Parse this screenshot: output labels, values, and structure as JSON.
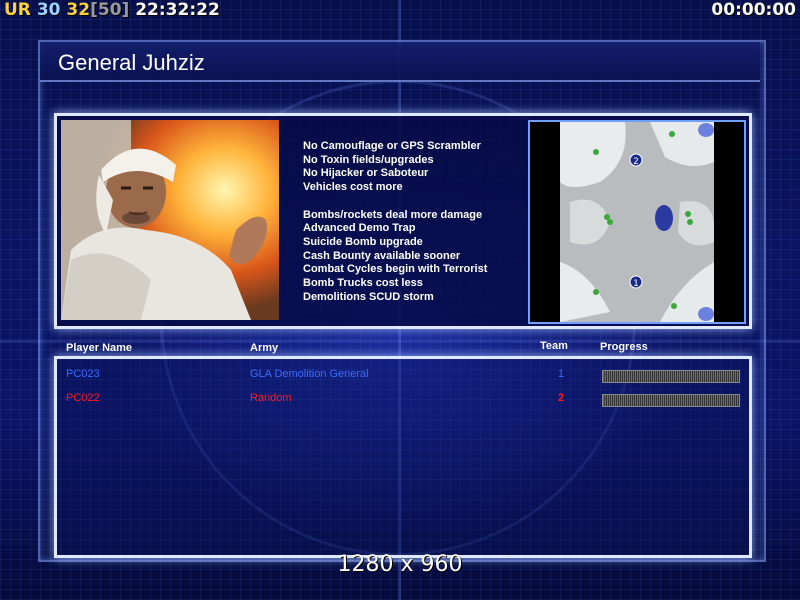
{
  "hud": {
    "tag": "UR",
    "fps": "30",
    "fps_current": "32",
    "fps_cap": "[50]",
    "clock": "22:32:22",
    "timer": "00:00:00"
  },
  "title": "General Juhziz",
  "traits": [
    "No Camouflage or GPS Scrambler",
    "No Toxin fields/upgrades",
    "No Hijacker or Saboteur",
    "Vehicles cost more",
    "",
    "Bombs/rockets deal more damage",
    "Advanced Demo Trap",
    "Suicide Bomb upgrade",
    "Cash Bounty available sooner",
    "Combat Cycles begin with Terrorist",
    "Bomb Trucks cost less",
    "Demolitions SCUD storm"
  ],
  "map": {
    "start_positions": [
      "2",
      "1"
    ]
  },
  "players": {
    "headers": {
      "name": "Player Name",
      "army": "Army",
      "team": "Team",
      "progress": "Progress"
    },
    "rows": [
      {
        "name": "PC023",
        "army": "GLA Demolition General",
        "team": "1",
        "color": "#3a6cff",
        "progress": 0
      },
      {
        "name": "PC022",
        "army": "Random",
        "team": "2",
        "color": "#ff1a1a",
        "progress": 0
      }
    ]
  },
  "resolution": "1280 x 960",
  "colors": {
    "frame": "#dfe8ff",
    "background": "#0a1460",
    "hud_yellow": "#ffd23a"
  }
}
